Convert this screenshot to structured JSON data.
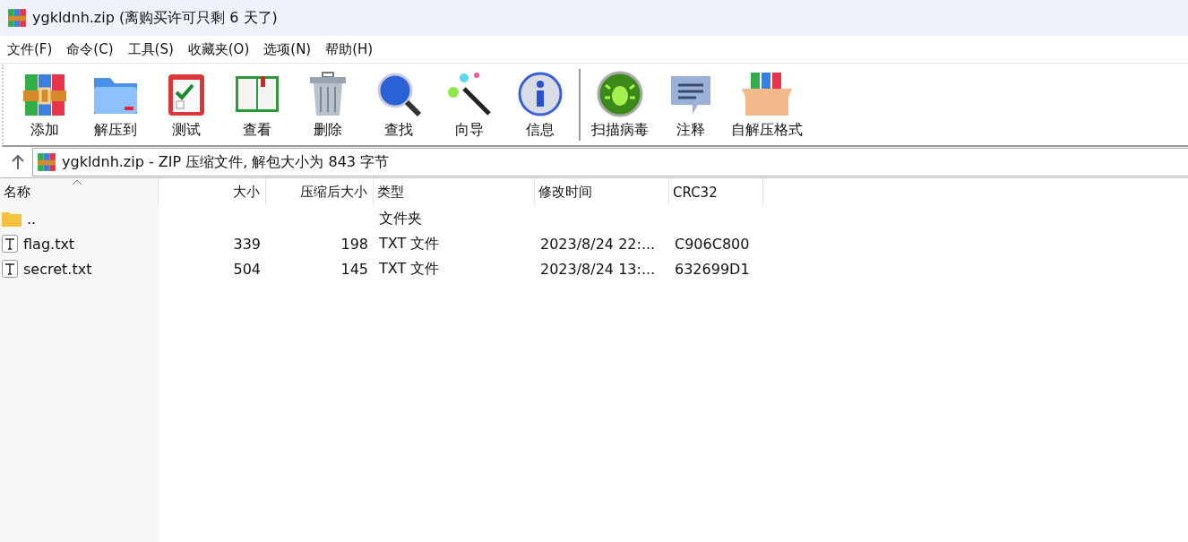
{
  "window": {
    "title": "ygkldnh.zip (离购买许可只剩 6 天了)"
  },
  "menu": [
    "文件(F)",
    "命令(C)",
    "工具(S)",
    "收藏夹(O)",
    "选项(N)",
    "帮助(H)"
  ],
  "toolbar": [
    {
      "kind": "books",
      "label": "添加"
    },
    {
      "kind": "folder",
      "label": "解压到"
    },
    {
      "kind": "clipboard",
      "label": "测试"
    },
    {
      "kind": "book",
      "label": "查看"
    },
    {
      "kind": "trash",
      "label": "删除"
    },
    {
      "kind": "magnifier",
      "label": "查找"
    },
    {
      "kind": "wand",
      "label": "向导"
    },
    {
      "kind": "info",
      "label": "信息"
    },
    {
      "kind": "separator"
    },
    {
      "kind": "bug",
      "label": "扫描病毒"
    },
    {
      "kind": "comment",
      "label": "注释"
    },
    {
      "kind": "box",
      "label": "自解压格式"
    }
  ],
  "address": {
    "text": "ygkldnh.zip - ZIP 压缩文件, 解包大小为 843 字节"
  },
  "table": {
    "columns": [
      {
        "label": "名称",
        "sorted": true
      },
      {
        "label": "大小",
        "sorted": false
      },
      {
        "label": "压缩后大小",
        "sorted": false
      },
      {
        "label": "类型",
        "sorted": false
      },
      {
        "label": "修改时间",
        "sorted": false
      },
      {
        "label": "CRC32",
        "sorted": false
      }
    ],
    "rows": [
      {
        "kind": "folder",
        "cells": [
          "..",
          "",
          "",
          "文件夹",
          "",
          ""
        ]
      },
      {
        "kind": "text",
        "cells": [
          "flag.txt",
          "339",
          "198",
          "TXT 文件",
          "2023/8/24 22:...",
          "C906C800"
        ]
      },
      {
        "kind": "text",
        "cells": [
          "secret.txt",
          "504",
          "145",
          "TXT 文件",
          "2023/8/24 13:...",
          "632699D1"
        ]
      }
    ]
  }
}
